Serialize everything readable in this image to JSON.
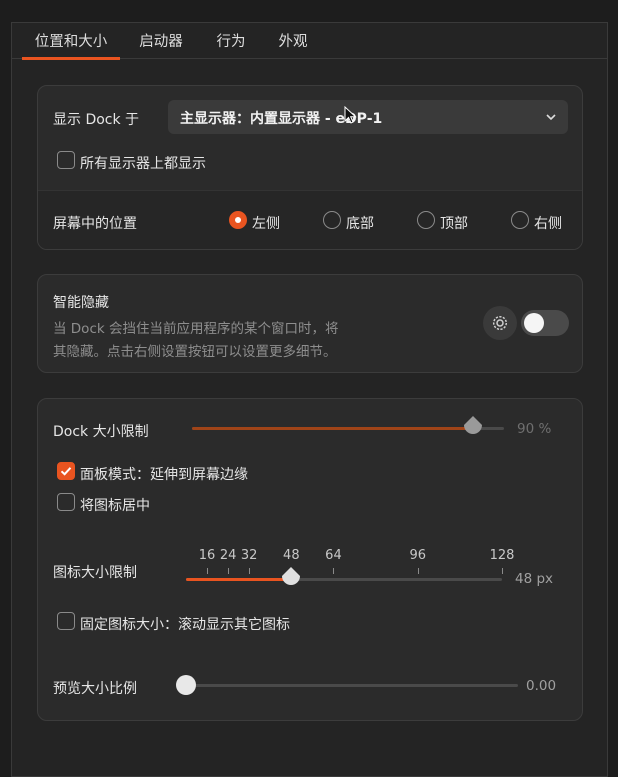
{
  "tabs": [
    "位置和大小",
    "启动器",
    "行为",
    "外观"
  ],
  "display": {
    "label": "显示 Dock 于",
    "selected": "主显示器：内置显示器 - eDP-1",
    "all_monitors_label": "所有显示器上都显示",
    "all_monitors_checked": false
  },
  "position": {
    "label": "屏幕中的位置",
    "options": [
      "左侧",
      "底部",
      "顶部",
      "右侧"
    ],
    "selected": "左侧"
  },
  "autohide": {
    "title": "智能隐藏",
    "desc1": "当 Dock 会挡住当前应用程序的某个窗口时，将",
    "desc2": "其隐藏。点击右侧设置按钮可以设置更多细节。",
    "enabled": false
  },
  "size": {
    "dock_label": "Dock 大小限制",
    "dock_value": "90 %",
    "dock_fraction": 0.9,
    "panel_mode_label": "面板模式：延伸到屏幕边缘",
    "panel_mode_checked": true,
    "center_icons_label": "将图标居中",
    "center_icons_checked": false,
    "icon_label": "图标大小限制",
    "icon_ticks": [
      "16",
      "24",
      "32",
      "48",
      "64",
      "96",
      "128"
    ],
    "icon_value": "48 px",
    "icon_size": 48,
    "fixed_icon_label": "固定图标大小：滚动显示其它图标",
    "fixed_icon_checked": false,
    "preview_label": "预览大小比例",
    "preview_value": "0.00",
    "preview_fraction": 0
  },
  "colors": {
    "accent": "#e95420",
    "background": "#242424",
    "panel": "#2b2b2b"
  },
  "icons": {
    "dropdown": "chevron-down-icon",
    "settings": "gear-icon",
    "mouse": "mouse-pointer-icon"
  }
}
